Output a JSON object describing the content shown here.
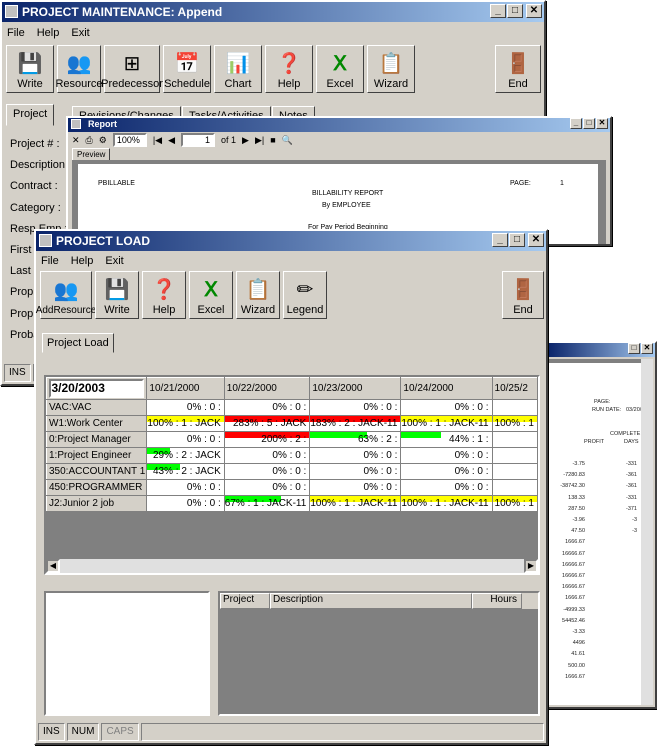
{
  "main_window": {
    "title": "PROJECT MAINTENANCE: Append",
    "menu": [
      "File",
      "Help",
      "Exit"
    ],
    "toolbar": [
      {
        "label": "Write",
        "icon": "floppy-icon",
        "glyph": "💾"
      },
      {
        "label": "Resource",
        "icon": "people-icon",
        "glyph": "👥"
      },
      {
        "label": "Predecessor",
        "icon": "tree-icon",
        "glyph": "⊞"
      },
      {
        "label": "Schedule",
        "icon": "calendar-icon",
        "glyph": "📅"
      },
      {
        "label": "Chart",
        "icon": "chart-icon",
        "glyph": "📊"
      },
      {
        "label": "Help",
        "icon": "help-icon",
        "glyph": "❓"
      },
      {
        "label": "Excel",
        "icon": "excel-icon",
        "glyph": "Ⅹ"
      },
      {
        "label": "Wizard",
        "icon": "wizard-icon",
        "glyph": "📋"
      },
      {
        "label": "End",
        "icon": "exit-icon",
        "glyph": "🚪"
      }
    ],
    "tabs": [
      "Project",
      "Revisions/Changes",
      "Tasks/Activities",
      "Notes"
    ],
    "fields": [
      "Project # :",
      "Description:",
      "Contract :",
      "Category :",
      "Resp Emp :",
      "First N",
      "Last N",
      "Prop T",
      "Prop P",
      "Probat"
    ],
    "status": [
      "INS",
      "N"
    ]
  },
  "report_window": {
    "title": "Report",
    "zoom": "100%",
    "page": "1",
    "of": "of 1",
    "tab": "Preview",
    "lines": {
      "left": "PBILLABLE",
      "title": "BILLABILITY REPORT",
      "sub": "By EMPLOYEE",
      "period": "For Pay Period Beginning",
      "page_label": "PAGE:",
      "page_num": "1"
    }
  },
  "report2": {
    "page": "PAGE:",
    "run_date": "RUN DATE:",
    "run_date_val": "03/20/2C",
    "complete": "COMPLETE",
    "profit": "PROFIT",
    "days": "DAYS",
    "profit_values": [
      "-3.75",
      "-7280.83",
      "-38742.30",
      "138.33",
      "287.50",
      "-3.96",
      "47.50",
      "1666.67",
      "16666.67",
      "16666.67",
      "16666.67",
      "16666.67",
      "1666.67",
      "-4999.33",
      "54452.46",
      "-3.33",
      "4496",
      "41.61",
      "500.00",
      "1666.67"
    ],
    "days_values": [
      "-331",
      "-361",
      "-361",
      "-331",
      "-371",
      "-3",
      "-3"
    ]
  },
  "load_window": {
    "title": "PROJECT LOAD",
    "menu": [
      "File",
      "Help",
      "Exit"
    ],
    "toolbar": [
      {
        "label": "AddResource",
        "icon": "add-resource-icon",
        "glyph": "👥"
      },
      {
        "label": "Write",
        "icon": "floppy-icon",
        "glyph": "💾"
      },
      {
        "label": "Help",
        "icon": "help-icon",
        "glyph": "❓"
      },
      {
        "label": "Excel",
        "icon": "excel-icon",
        "glyph": "Ⅹ"
      },
      {
        "label": "Wizard",
        "icon": "wizard-icon",
        "glyph": "📋"
      },
      {
        "label": "Legend",
        "icon": "legend-icon",
        "glyph": "✏"
      },
      {
        "label": "End",
        "icon": "exit-icon",
        "glyph": "🚪"
      }
    ],
    "tab": "Project Load",
    "date_input": "3/20/2003",
    "columns": [
      "10/21/2000",
      "10/22/2000",
      "10/23/2000",
      "10/24/2000",
      "10/25/2"
    ],
    "rows": [
      {
        "name": "VAC:VAC",
        "cells": [
          {
            "t": "0% : 0 :"
          },
          {
            "t": "0% : 0 :"
          },
          {
            "t": "0% : 0 :"
          },
          {
            "t": "0% : 0 :"
          },
          {
            "t": ""
          }
        ]
      },
      {
        "name": "W1:Work Center",
        "cells": [
          {
            "t": "100% : 1 : JACK",
            "c": "#ffff00",
            "w": 1
          },
          {
            "t": "283% : 5 : JACK",
            "c": "#ff0000",
            "w": 1
          },
          {
            "t": "183% : 2 : JACK-11",
            "c": "#ff0000",
            "w": 1
          },
          {
            "t": "100% : 1 : JACK-11",
            "c": "#ffff00",
            "w": 1
          },
          {
            "t": "100% : 1",
            "c": "#ffff00",
            "w": 1
          }
        ]
      },
      {
        "name": "0:Project Manager",
        "cells": [
          {
            "t": "0% : 0 :"
          },
          {
            "t": "200% : 2 :",
            "c": "#ff0000",
            "w": 1
          },
          {
            "t": "63% : 2 :",
            "c": "#00ff00",
            "w": 0.63
          },
          {
            "t": "44% : 1 :",
            "c": "#00ff00",
            "w": 0.44
          },
          {
            "t": ""
          }
        ]
      },
      {
        "name": "1:Project Engineer",
        "cells": [
          {
            "t": "29% : 2 : JACK",
            "c": "#00ff00",
            "w": 0.29
          },
          {
            "t": "0% : 0 :"
          },
          {
            "t": "0% : 0 :"
          },
          {
            "t": "0% : 0 :"
          },
          {
            "t": ""
          }
        ]
      },
      {
        "name": "350:ACCOUNTANT 1",
        "cells": [
          {
            "t": "43% : 2 : JACK",
            "c": "#00ff00",
            "w": 0.43
          },
          {
            "t": "0% : 0 :"
          },
          {
            "t": "0% : 0 :"
          },
          {
            "t": "0% : 0 :"
          },
          {
            "t": ""
          }
        ]
      },
      {
        "name": "450:PROGRAMMER",
        "cells": [
          {
            "t": "0% : 0 :"
          },
          {
            "t": "0% : 0 :"
          },
          {
            "t": "0% : 0 :"
          },
          {
            "t": "0% : 0 :"
          },
          {
            "t": ""
          }
        ]
      },
      {
        "name": "J2:Junior 2 job",
        "cells": [
          {
            "t": "0% : 0 :"
          },
          {
            "t": "67% : 1 : JACK-11",
            "c": "#00ff00",
            "w": 0.67
          },
          {
            "t": "100% : 1 : JACK-11",
            "c": "#ffff00",
            "w": 1
          },
          {
            "t": "100% : 1 : JACK-11",
            "c": "#ffff00",
            "w": 1
          },
          {
            "t": "100% : 1",
            "c": "#ffff00",
            "w": 1
          }
        ]
      }
    ],
    "detail_columns": [
      "Project",
      "Description",
      "Hours"
    ],
    "status": [
      "INS",
      "NUM",
      "CAPS"
    ]
  }
}
